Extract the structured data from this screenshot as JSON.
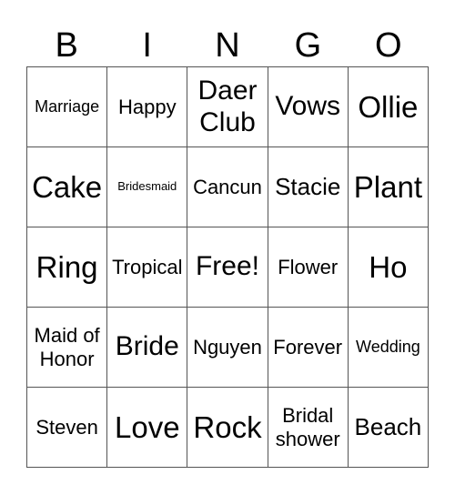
{
  "title_letters": [
    "B",
    "I",
    "N",
    "G",
    "O"
  ],
  "cells": [
    [
      "Marriage",
      "Happy",
      "Daer Club",
      "Vows",
      "Ollie"
    ],
    [
      "Cake",
      "Bridesmaid",
      "Cancun",
      "Stacie",
      "Plant"
    ],
    [
      "Ring",
      "Tropical",
      "Free!",
      "Flower",
      "Ho"
    ],
    [
      "Maid of Honor",
      "Bride",
      "Nguyen",
      "Forever",
      "Wedding"
    ],
    [
      "Steven",
      "Love",
      "Rock",
      "Bridal shower",
      "Beach"
    ]
  ]
}
